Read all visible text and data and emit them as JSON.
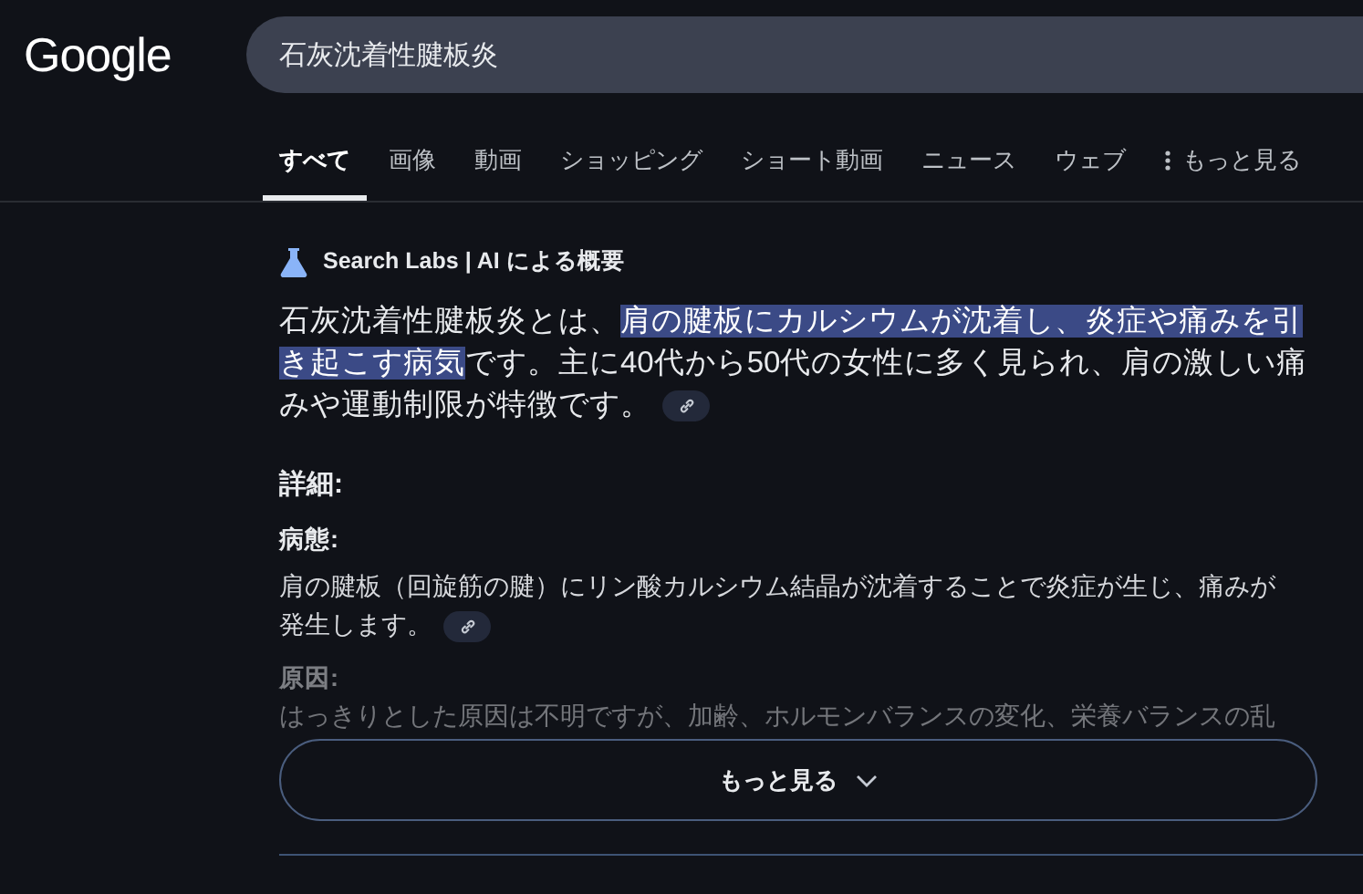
{
  "header": {
    "logo": "Google",
    "search": {
      "value": "石灰沈着性腱板炎"
    }
  },
  "tabs": [
    {
      "label": "すべて",
      "selected": true
    },
    {
      "label": "画像",
      "selected": false
    },
    {
      "label": "動画",
      "selected": false
    },
    {
      "label": "ショッピング",
      "selected": false
    },
    {
      "label": "ショート動画",
      "selected": false
    },
    {
      "label": "ニュース",
      "selected": false
    },
    {
      "label": "ウェブ",
      "selected": false
    },
    {
      "label": "もっと見る",
      "selected": false,
      "kind": "more"
    }
  ],
  "overview": {
    "source": "Search Labs | AI による概要",
    "summary": [
      {
        "text": "石灰沈着性腱板炎とは、",
        "highlighted": false
      },
      {
        "text": "肩の腱板にカルシウムが沈着し、炎症や痛みを引き起こす病気",
        "highlighted": true
      },
      {
        "text": "です。主に40代から50代の女性に多く見られ、肩の激しい痛みや運動制限が特徴です。",
        "highlighted": false
      }
    ],
    "details_heading": "詳細:",
    "sections": [
      {
        "title": "病態:",
        "body": "肩の腱板（回旋筋の腱）にリン酸カルシウム結晶が沈着することで炎症が生じ、痛みが発生します。",
        "faded": false,
        "cited": true
      },
      {
        "title": "原因:",
        "body": "はっきりとした原因は不明ですが、加齢、ホルモンバランスの変化、栄養バランスの乱",
        "faded": true,
        "cited": false
      }
    ],
    "more_button": "もっと見る"
  }
}
